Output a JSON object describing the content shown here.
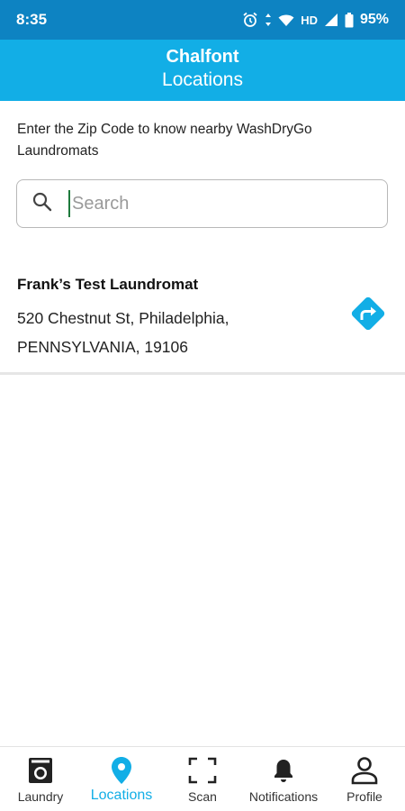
{
  "status_bar": {
    "time": "8:35",
    "network": "HD",
    "battery": "95%",
    "icons": [
      "alarm-icon",
      "data-arrows-icon",
      "wifi-icon",
      "signal-icon",
      "battery-icon"
    ]
  },
  "header": {
    "title": "Chalfont",
    "subtitle": "Locations"
  },
  "intro_text": "Enter the Zip Code to know nearby WashDryGo Laundromats",
  "search": {
    "value": "",
    "placeholder": "Search"
  },
  "locations": [
    {
      "name": "Frank’s Test Laundromat",
      "address_line1": "520 Chestnut St, Philadelphia,",
      "address_line2": "PENNSYLVANIA, 19106"
    }
  ],
  "bottom_nav": {
    "items": [
      {
        "label": "Laundry",
        "icon": "washing-machine-icon"
      },
      {
        "label": "Locations",
        "icon": "location-pin-icon",
        "active": true
      },
      {
        "label": "Scan",
        "icon": "scan-frame-icon"
      },
      {
        "label": "Notifications",
        "icon": "bell-icon"
      },
      {
        "label": "Profile",
        "icon": "person-icon"
      }
    ]
  },
  "colors": {
    "status_bar": "#0d83c2",
    "header": "#12aee6",
    "accent": "#12aee6"
  }
}
